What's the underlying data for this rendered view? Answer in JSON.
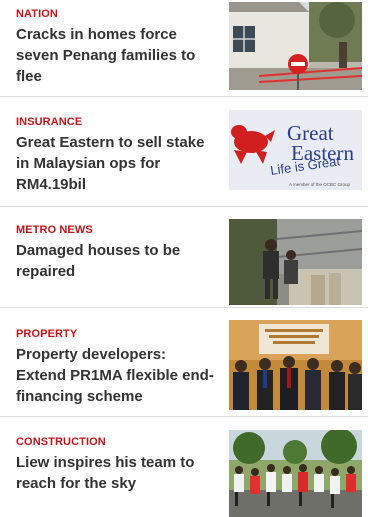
{
  "theme": {
    "category_color": "#c0141a",
    "headline_color": "#333333",
    "divider_color": "#dcdcdc"
  },
  "articles": [
    {
      "category": "NATION",
      "headline": "Cracks in homes force seven Penang families to flee",
      "thumbnail_icon": "damaged-house-photo"
    },
    {
      "category": "INSURANCE",
      "headline": "Great Eastern to sell stake in Malaysian ops for RM4.19bil",
      "thumbnail_icon": "great-eastern-logo",
      "logo": {
        "line1": "Great",
        "line2": "Eastern",
        "tagline": "Life is Great",
        "subtag": "A member of the OCBC Group"
      }
    },
    {
      "category": "METRO NEWS",
      "headline": "Damaged houses to be repaired",
      "thumbnail_icon": "workers-at-house-photo"
    },
    {
      "category": "PROPERTY",
      "headline": "Property developers: Extend PR1MA flexible end-financing scheme",
      "thumbnail_icon": "group-of-officials-photo"
    },
    {
      "category": "CONSTRUCTION",
      "headline": "Liew inspires his team to reach for the sky",
      "thumbnail_icon": "runners-crowd-photo"
    }
  ]
}
